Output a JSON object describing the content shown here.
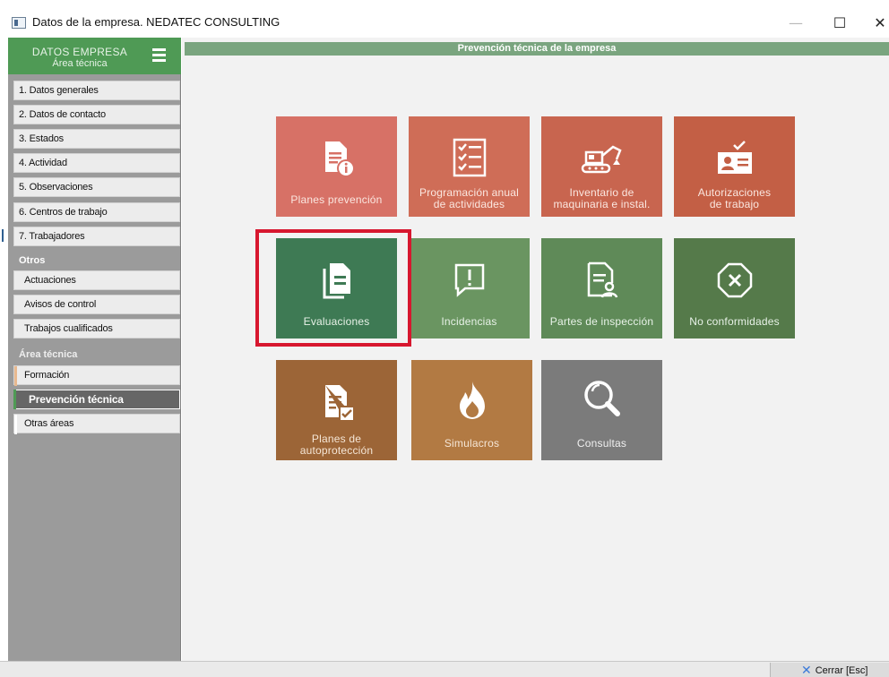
{
  "window": {
    "title": "Datos de la empresa. NEDATEC CONSULTING",
    "minimize": "—",
    "maximize": "☐",
    "close": "✕"
  },
  "sidebar": {
    "header_title": "DATOS EMPRESA",
    "header_subtitle": "Área técnica",
    "menu_icon": "hamburger-icon",
    "items": [
      {
        "label": "1. Datos generales"
      },
      {
        "label": "2. Datos de contacto"
      },
      {
        "label": "3. Estados"
      },
      {
        "label": "4. Actividad"
      },
      {
        "label": "5. Observaciones"
      },
      {
        "label": "6. Centros de trabajo"
      },
      {
        "label": "7. Trabajadores"
      }
    ],
    "section_otros": "Otros",
    "otros_items": [
      {
        "label": "Actuaciones"
      },
      {
        "label": "Avisos de control"
      },
      {
        "label": "Trabajos cualificados"
      }
    ],
    "section_area": "Área técnica",
    "area_items": [
      {
        "label": "Formación",
        "marker_color": "#e8b98f"
      },
      {
        "label": "Prevención técnica",
        "marker_color": "#4f9a55",
        "active": true
      },
      {
        "label": "Otras áreas",
        "marker_color": "#ffffff"
      }
    ]
  },
  "main": {
    "header": "Prevención técnica de la empresa",
    "tiles": [
      {
        "label_1": "Planes prevención",
        "label_2": "",
        "color": "#d77166",
        "icon": "document-info-icon"
      },
      {
        "label_1": "Programación anual",
        "label_2": "de actividades",
        "color": "#cf6d57",
        "icon": "checklist-icon"
      },
      {
        "label_1": "Inventario de",
        "label_2": "maquinaria e instal.",
        "color": "#c8654f",
        "icon": "excavator-icon"
      },
      {
        "label_1": "Autorizaciones",
        "label_2": "de trabajo",
        "color": "#c35f45",
        "icon": "id-card-check-icon"
      },
      {
        "label_1": "Evaluaciones",
        "label_2": "",
        "color": "#3e7a54",
        "icon": "documents-icon",
        "selected": true
      },
      {
        "label_1": "Incidencias",
        "label_2": "",
        "color": "#6a9561",
        "icon": "alert-message-icon"
      },
      {
        "label_1": "Partes de inspección",
        "label_2": "",
        "color": "#5f8a58",
        "icon": "document-user-icon"
      },
      {
        "label_1": "No conformidades",
        "label_2": "",
        "color": "#557a4a",
        "icon": "circle-x-icon"
      },
      {
        "label_1": "Planes de",
        "label_2": "autoprotección",
        "color": "#9c6537",
        "icon": "document-check-icon"
      },
      {
        "label_1": "Simulacros",
        "label_2": "",
        "color": "#b27a43",
        "icon": "fire-icon"
      },
      {
        "label_1": "Consultas",
        "label_2": "",
        "color": "#7b7b7b",
        "icon": "search-icon"
      }
    ]
  },
  "statusbar": {
    "close_label": "Cerrar [Esc]",
    "close_icon": "close-x-icon"
  }
}
